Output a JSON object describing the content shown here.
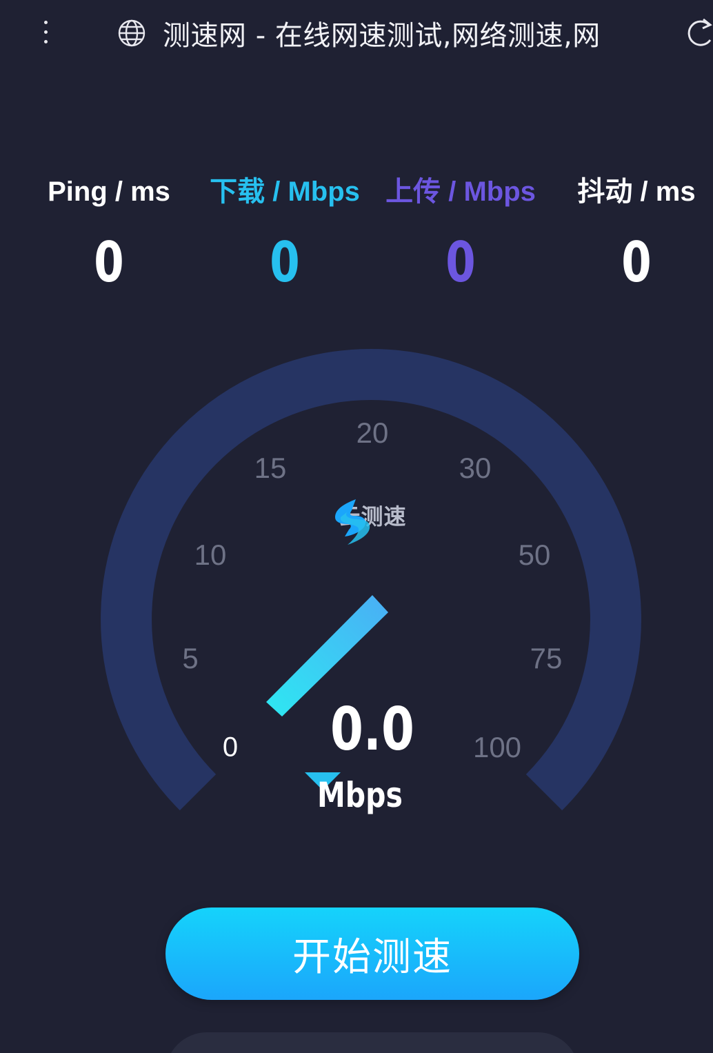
{
  "browser": {
    "title": "测速网 - 在线网速测试,网络测速,网"
  },
  "metrics": [
    {
      "label": "Ping / ms",
      "value": "0",
      "color": "#ffffff"
    },
    {
      "label": "下载 / Mbps",
      "value": "0",
      "color": "#27c0ef"
    },
    {
      "label": "上传 / Mbps",
      "value": "0",
      "color": "#6c56e0"
    },
    {
      "label": "抖动 / ms",
      "value": "0",
      "color": "#ffffff"
    }
  ],
  "gauge": {
    "ticks": [
      "0",
      "5",
      "10",
      "15",
      "20",
      "30",
      "50",
      "75",
      "100"
    ],
    "current_value": "0.0",
    "unit": "Mbps",
    "brand": "云测速",
    "needle_value": 0
  },
  "actions": {
    "start_label": "开始测速"
  },
  "colors": {
    "background": "#1f2133",
    "gauge_track": "#263463",
    "accent": "#1ba6fb",
    "download": "#27c0ef",
    "upload": "#6c56e0"
  }
}
